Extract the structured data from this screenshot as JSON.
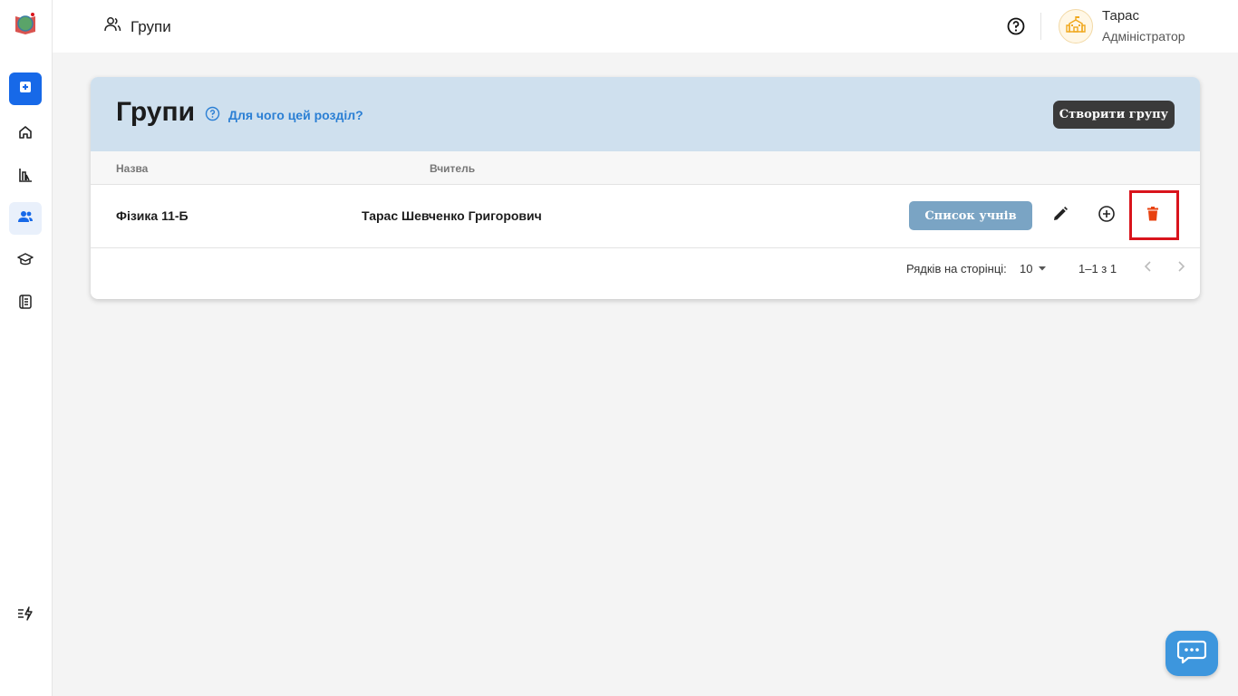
{
  "header": {
    "section_title": "Групи",
    "user": {
      "name": "Тарас",
      "role": "Адміністратор"
    }
  },
  "sidebar": {
    "items": [
      {
        "icon": "plus-square-icon"
      },
      {
        "icon": "home-icon"
      },
      {
        "icon": "stats-icon"
      },
      {
        "icon": "groups-icon",
        "active": true
      },
      {
        "icon": "graduation-cap-icon"
      },
      {
        "icon": "journal-icon"
      },
      {
        "icon": "changelog-icon"
      }
    ]
  },
  "card": {
    "title": "Групи",
    "why_link": "Для чого цей розділ?",
    "create_button": "Створити групу",
    "columns": {
      "name": "Назва",
      "teacher": "Вчитель"
    },
    "rows": [
      {
        "name": "Фізика 11-Б",
        "teacher": "Тарас Шевченко Григорович",
        "list_button": "Список учнів"
      }
    ],
    "pagination": {
      "rows_per_page_label": "Рядків на сторінці:",
      "rows_per_page": "10",
      "range": "1–1 з 1"
    }
  },
  "colors": {
    "accent": "#1769e8",
    "card_header": "#cfe0ee",
    "link": "#2b7fd4",
    "delete": "#e8410f",
    "highlight": "#d9141c",
    "chat": "#3d96dd"
  }
}
